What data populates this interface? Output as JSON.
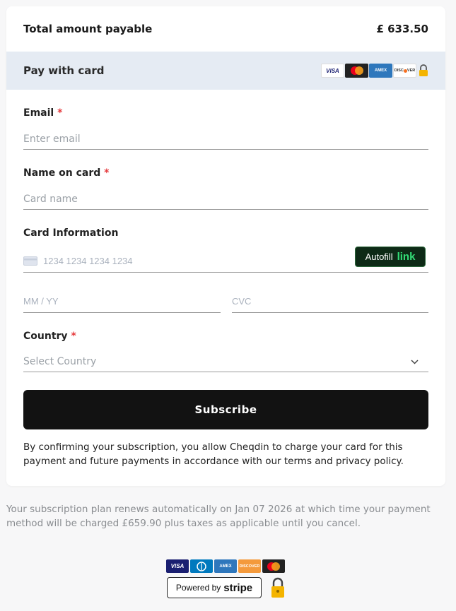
{
  "summary": {
    "total_label": "Total amount payable",
    "total_value": "£ 633.50"
  },
  "payment": {
    "title": "Pay with card",
    "brands": [
      "visa-icon",
      "mastercard-icon",
      "amex-icon",
      "discover-icon",
      "lock-icon"
    ]
  },
  "form": {
    "email": {
      "label": "Email",
      "required": "*",
      "placeholder": "Enter email"
    },
    "name": {
      "label": "Name on card",
      "required": "*",
      "placeholder": "Card name"
    },
    "card": {
      "label": "Card Information",
      "number_placeholder": "1234 1234 1234 1234",
      "autofill_label": "Autofill",
      "link_label": "link",
      "expiry_placeholder": "MM / YY",
      "cvc_placeholder": "CVC"
    },
    "country": {
      "label": "Country",
      "required": "*",
      "placeholder": "Select Country"
    }
  },
  "subscribe_label": "Subscribe",
  "consent_text": "By confirming your subscription, you allow Cheqdin to charge your card for this payment and future payments in accordance with our terms and privacy policy.",
  "renewal_text": "Your subscription plan renews automatically on Jan 07 2026 at which time your payment method will be charged £659.90 plus taxes as applicable until you cancel.",
  "footer": {
    "powered_by": "Powered by",
    "stripe": "stripe"
  },
  "colors": {
    "accent_dark": "#121212",
    "required": "#e5383b",
    "link_green": "#33dd77",
    "pay_header_bg": "#e5ebf3"
  }
}
